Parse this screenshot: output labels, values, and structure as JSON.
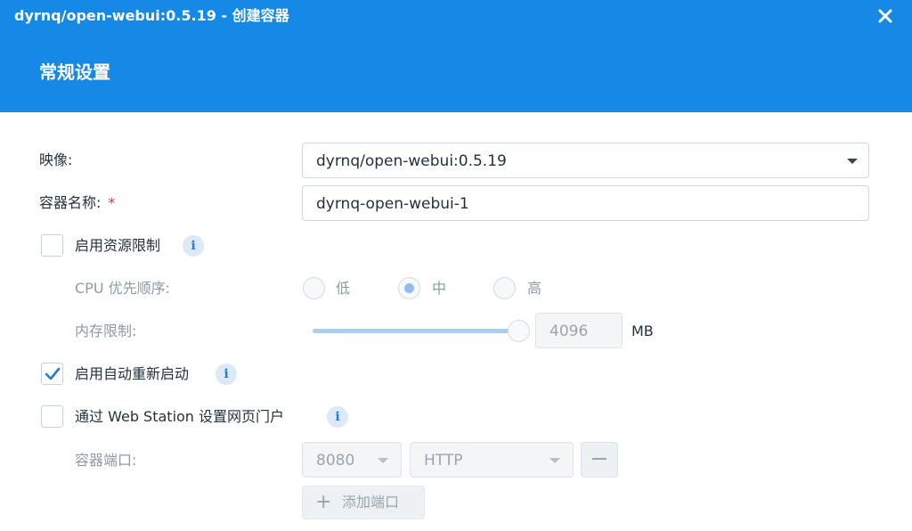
{
  "window": {
    "title": "dyrnq/open-webui:0.5.19 - 创建容器",
    "section_title": "常规设置",
    "close_icon": "close-icon"
  },
  "form": {
    "image": {
      "label": "映像:",
      "value": "dyrnq/open-webui:0.5.19"
    },
    "container_name": {
      "label": "容器名称:",
      "required_mark": "*",
      "value": "dyrnq-open-webui-1"
    },
    "resource_limit": {
      "label": "启用资源限制",
      "checked": false,
      "info_icon": "info-icon"
    },
    "cpu_priority": {
      "label": "CPU 优先顺序:",
      "options": [
        "低",
        "中",
        "高"
      ],
      "selected": "中"
    },
    "memory_limit": {
      "label": "内存限制:",
      "value": "4096",
      "unit": "MB",
      "slider_level": 1.0
    },
    "auto_restart": {
      "label": "启用自动重新启动",
      "checked": true,
      "info_icon": "info-icon"
    },
    "web_station": {
      "label": "通过 Web Station 设置网页门户",
      "checked": false,
      "info_icon": "info-icon"
    },
    "container_port": {
      "label": "容器端口:",
      "port": "8080",
      "protocol": "HTTP"
    },
    "add_port_label": "添加端口",
    "info_glyph": "i"
  },
  "colors": {
    "header": "#1689e6",
    "accent": "#1a7fd8",
    "required": "#e03a3a"
  }
}
